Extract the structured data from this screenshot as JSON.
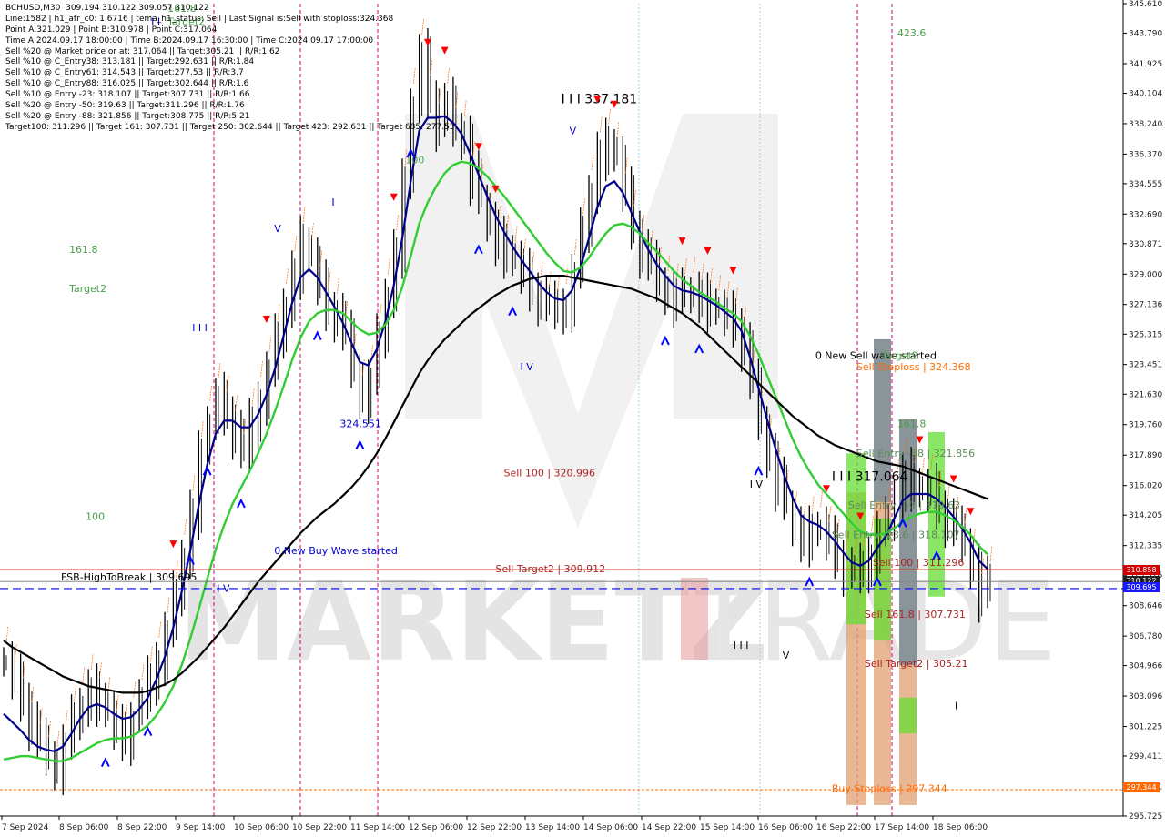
{
  "info_panel": {
    "lines": [
      "BCHUSD,M30  309.194 310.122 309.057 310.122",
      "Line:1582 | h1_atr_c0: 1.6716 | tema_h1_status: Sell | Last Signal is:Sell with stoploss:324.368",
      "Point A:321.029 | Point B:310.978 | Point C:317.064",
      "Time A:2024.09.17 18:00:00 | Time B:2024.09.17 16:30:00 | Time C:2024.09.17 17:00:00",
      "Sell %20 @ Market price or at: 317.064 || Target:305.21 || R/R:1.62",
      "Sell %10 @ C_Entry38: 313.181 || Target:292.631 || R/R:1.84",
      "Sell %10 @ C_Entry61: 314.543 || Target:277.53 || R/R:3.7",
      "Sell %10 @ C_Entry88: 316.025 || Target:302.644 || R/R:1.6",
      "Sell %10 @ Entry -23: 318.107 || Target:307.731 || R/R:1.66",
      "Sell %20 @ Entry -50: 319.63 || Target:311.296 || R/R:1.76",
      "Sell %20 @ Entry -88: 321.856 || Target:308.775 || R/R:5.21",
      "Target100: 311.296 || Target 161: 307.731 || Target 250: 302.644 || Target 423: 292.631 || Target 685: 277.53"
    ]
  },
  "price_tags": {
    "red": "310.858",
    "dark": "310.122",
    "blue": "309.695",
    "orange": "297.344"
  },
  "colors": {
    "candle": "#000000",
    "ma_blue": "#00008b",
    "ma_green": "#32cd32",
    "ma_black": "#000000",
    "resistance": "#d10000",
    "support_blue": "#0000ff",
    "stoploss": "#ff6a00",
    "session_line": "#cc0077",
    "watermark": "#d9d9d9"
  },
  "chart_data": {
    "type": "candlestick",
    "symbol": "BCHUSD,M30",
    "y_ticks": [
      "345.610",
      "343.790",
      "341.925",
      "340.104",
      "338.240",
      "336.370",
      "334.555",
      "332.690",
      "330.871",
      "329.000",
      "327.136",
      "325.315",
      "323.451",
      "321.630",
      "319.760",
      "317.890",
      "316.020",
      "314.205",
      "312.335",
      "310.516",
      "308.646",
      "306.780",
      "304.966",
      "303.096",
      "301.225",
      "299.411",
      "297.541",
      "295.725"
    ],
    "ylim": [
      295.725,
      345.61
    ],
    "x_ticks": [
      "7 Sep 2024",
      "8 Sep 06:00",
      "8 Sep 22:00",
      "9 Sep 14:00",
      "10 Sep 06:00",
      "10 Sep 22:00",
      "11 Sep 14:00",
      "12 Sep 06:00",
      "12 Sep 22:00",
      "13 Sep 14:00",
      "14 Sep 06:00",
      "14 Sep 22:00",
      "15 Sep 14:00",
      "16 Sep 06:00",
      "16 Sep 22:00",
      "17 Sep 14:00",
      "18 Sep 06:00"
    ],
    "close": [
      305.2,
      304.1,
      303.0,
      301.5,
      300.2,
      299.4,
      298.8,
      300.1,
      301.6,
      302.7,
      303.5,
      303.0,
      302.1,
      301.0,
      300.6,
      301.8,
      302.9,
      304.0,
      305.5,
      307.0,
      309.2,
      311.8,
      314.5,
      317.8,
      320.0,
      321.4,
      320.6,
      319.4,
      318.0,
      319.8,
      321.5,
      323.0,
      325.0,
      327.2,
      329.2,
      331.0,
      330.0,
      328.3,
      327.0,
      326.6,
      325.2,
      323.2,
      321.6,
      322.5,
      325.0,
      327.8,
      330.5,
      334.5,
      339.5,
      342.5,
      340.0,
      338.3,
      339.5,
      338.0,
      337.5,
      335.0,
      333.6,
      332.2,
      331.0,
      330.5,
      329.8,
      329.0,
      328.2,
      327.6,
      327.0,
      326.8,
      327.2,
      329.0,
      331.5,
      334.2,
      336.5,
      337.0,
      336.2,
      334.0,
      332.0,
      330.5,
      329.5,
      328.5,
      328.0,
      327.5,
      327.8,
      327.9,
      327.5,
      327.2,
      326.8,
      326.4,
      326.0,
      324.8,
      322.2,
      320.0,
      318.0,
      316.2,
      314.8,
      313.5,
      312.8,
      313.2,
      313.5,
      312.6,
      311.8,
      311.0,
      310.6,
      310.9,
      312.0,
      313.2,
      313.8,
      315.5,
      316.8,
      316.2,
      315.6,
      315.8,
      314.8,
      314.0,
      313.2,
      312.5,
      311.2,
      309.4,
      310.122
    ],
    "series": [
      {
        "name": "fast MA (navy)",
        "values": [
          302.0,
          301.5,
          301.0,
          300.4,
          300.0,
          299.8,
          299.7,
          300.0,
          300.8,
          301.7,
          302.4,
          302.6,
          302.4,
          302.0,
          301.7,
          301.8,
          302.3,
          303.0,
          304.1,
          305.5,
          307.3,
          309.5,
          312.0,
          314.8,
          317.3,
          319.2,
          320.0,
          320.0,
          319.6,
          319.6,
          320.4,
          321.6,
          323.2,
          325.2,
          327.2,
          328.8,
          329.3,
          328.8,
          327.9,
          327.0,
          326.0,
          324.8,
          323.6,
          323.4,
          324.4,
          326.1,
          328.3,
          331.2,
          334.7,
          337.8,
          338.6,
          338.6,
          338.7,
          338.3,
          337.6,
          336.4,
          335.1,
          333.8,
          332.6,
          331.6,
          330.7,
          329.9,
          329.2,
          328.5,
          327.9,
          327.5,
          327.4,
          328.0,
          329.4,
          331.2,
          333.1,
          334.4,
          334.7,
          334.0,
          332.8,
          331.6,
          330.5,
          329.6,
          328.9,
          328.3,
          328.0,
          327.9,
          327.7,
          327.4,
          327.1,
          326.7,
          326.3,
          325.5,
          323.9,
          322.0,
          320.1,
          318.3,
          316.7,
          315.3,
          314.2,
          313.8,
          313.6,
          313.2,
          312.6,
          311.9,
          311.3,
          311.1,
          311.4,
          312.2,
          312.9,
          314.0,
          315.1,
          315.5,
          315.5,
          315.5,
          315.2,
          314.7,
          314.1,
          313.4,
          312.5,
          311.4,
          310.9
        ]
      },
      {
        "name": "slow MA (green)",
        "values": [
          299.2,
          299.3,
          299.4,
          299.4,
          299.3,
          299.2,
          299.1,
          299.1,
          299.3,
          299.6,
          299.9,
          300.2,
          300.4,
          300.5,
          300.5,
          300.6,
          300.9,
          301.3,
          301.9,
          302.7,
          303.7,
          305.0,
          306.6,
          308.4,
          310.3,
          312.1,
          313.6,
          314.9,
          315.9,
          316.9,
          318.0,
          319.2,
          320.6,
          322.1,
          323.7,
          325.1,
          326.1,
          326.6,
          326.8,
          326.8,
          326.6,
          326.1,
          325.6,
          325.3,
          325.4,
          325.9,
          326.8,
          328.2,
          330.1,
          332.1,
          333.4,
          334.4,
          335.2,
          335.7,
          335.9,
          335.8,
          335.5,
          335.0,
          334.4,
          333.8,
          333.1,
          332.4,
          331.7,
          331.0,
          330.3,
          329.7,
          329.2,
          329.1,
          329.4,
          330.0,
          330.8,
          331.5,
          332.0,
          332.1,
          331.9,
          331.5,
          330.9,
          330.4,
          329.8,
          329.2,
          328.7,
          328.3,
          327.9,
          327.6,
          327.3,
          326.9,
          326.6,
          326.1,
          325.2,
          324.1,
          322.8,
          321.5,
          320.2,
          318.9,
          317.8,
          316.9,
          316.1,
          315.5,
          314.9,
          314.3,
          313.7,
          313.2,
          313.0,
          313.0,
          313.1,
          313.4,
          313.8,
          314.1,
          314.3,
          314.4,
          314.4,
          314.2,
          313.9,
          313.5,
          313.0,
          312.3,
          311.8
        ]
      },
      {
        "name": "long MA (black)",
        "values": [
          306.5,
          306.1,
          305.8,
          305.5,
          305.2,
          304.9,
          304.6,
          304.3,
          304.1,
          303.9,
          303.7,
          303.6,
          303.5,
          303.4,
          303.3,
          303.3,
          303.3,
          303.4,
          303.6,
          303.8,
          304.1,
          304.5,
          305.0,
          305.5,
          306.1,
          306.7,
          307.3,
          308.0,
          308.7,
          309.4,
          310.1,
          310.7,
          311.3,
          311.9,
          312.5,
          313.1,
          313.6,
          314.1,
          314.5,
          314.9,
          315.4,
          315.9,
          316.5,
          317.2,
          318.0,
          318.9,
          319.9,
          320.9,
          321.9,
          322.9,
          323.7,
          324.4,
          325.0,
          325.5,
          326.0,
          326.5,
          326.9,
          327.3,
          327.7,
          328.0,
          328.3,
          328.5,
          328.7,
          328.8,
          328.9,
          328.9,
          328.9,
          328.8,
          328.7,
          328.6,
          328.5,
          328.4,
          328.3,
          328.2,
          328.1,
          327.9,
          327.7,
          327.5,
          327.2,
          326.9,
          326.6,
          326.2,
          325.8,
          325.3,
          324.8,
          324.3,
          323.8,
          323.3,
          322.8,
          322.3,
          321.8,
          321.3,
          320.8,
          320.3,
          319.9,
          319.5,
          319.1,
          318.8,
          318.5,
          318.3,
          318.1,
          317.9,
          317.7,
          317.5,
          317.4,
          317.3,
          317.2,
          317.0,
          316.8,
          316.6,
          316.4,
          316.2,
          316.0,
          315.8,
          315.6,
          315.4,
          315.2
        ]
      }
    ],
    "levels": {
      "resistance_red": 310.858,
      "current_price": 310.122,
      "fsb_blue_dashed": 309.695,
      "buy_stoploss": 297.344
    },
    "annotations": [
      {
        "text": "161.8",
        "color": "#4a9e4a",
        "x": 20,
        "y": 345.1
      },
      {
        "text": "Target2",
        "color": "#4a9e4a",
        "x": 20,
        "y": 344.3
      },
      {
        "text": "I I",
        "color": "#0000cc",
        "x": 18,
        "y": 344.3
      },
      {
        "text": "423.6",
        "color": "#4a9e4a",
        "x": 109,
        "y": 343.6
      },
      {
        "text": "I I I 337.181",
        "color": "#000000",
        "x": 68,
        "y": 339.5
      },
      {
        "text": "V",
        "color": "#0000cc",
        "x": 69,
        "y": 337.6
      },
      {
        "text": "100",
        "color": "#4a9e4a",
        "x": 49,
        "y": 335.8
      },
      {
        "text": "I",
        "color": "#0000cc",
        "x": 40,
        "y": 333.2
      },
      {
        "text": "V",
        "color": "#0000cc",
        "x": 33,
        "y": 331.6
      },
      {
        "text": "161.8",
        "color": "#4a9e4a",
        "x": 8,
        "y": 330.3
      },
      {
        "text": "Target2",
        "color": "#4a9e4a",
        "x": 8,
        "y": 327.9
      },
      {
        "text": "I I I",
        "color": "#0000cc",
        "x": 23,
        "y": 325.5
      },
      {
        "text": "I V",
        "color": "#0000cc",
        "x": 63,
        "y": 323.1
      },
      {
        "text": "0 New Sell wave started",
        "color": "#000000",
        "x": 99,
        "y": 323.8
      },
      {
        "text": "Target2",
        "color": "#4a9e4a",
        "x": 107,
        "y": 323.8
      },
      {
        "text": "Sell Stoploss | 324.368",
        "color": "#ff6a00",
        "x": 104,
        "y": 323.1
      },
      {
        "text": "324.551",
        "color": "#0000cc",
        "x": 41,
        "y": 319.6
      },
      {
        "text": "161.8",
        "color": "#4a9e4a",
        "x": 109,
        "y": 319.6
      },
      {
        "text": "Sell Entry -88 | 321.856",
        "color": "#5b8a5b",
        "x": 104,
        "y": 317.8
      },
      {
        "text": "Sell 100 | 320.996",
        "color": "#b22222",
        "x": 61,
        "y": 316.6
      },
      {
        "text": "I I I 317.064",
        "color": "#000000",
        "x": 101,
        "y": 316.3
      },
      {
        "text": "I V",
        "color": "#000000",
        "x": 91,
        "y": 315.9
      },
      {
        "text": "Sell Entry -50 | 319.63",
        "color": "#5b8a5b",
        "x": 103,
        "y": 314.6
      },
      {
        "text": "100",
        "color": "#4a9e4a",
        "x": 10,
        "y": 313.9
      },
      {
        "text": "I V",
        "color": "#0000cc",
        "x": 26,
        "y": 309.5
      },
      {
        "text": "Sell Entry -23.6 | 318.107",
        "color": "#5b8a5b",
        "x": 101,
        "y": 312.8
      },
      {
        "text": "0 New Buy Wave started",
        "color": "#0000cc",
        "x": 33,
        "y": 311.8
      },
      {
        "text": "FSB-HighToBreak | 309.695",
        "color": "#000000",
        "x": 7,
        "y": 310.2
      },
      {
        "text": "Sell Target2 | 309.912",
        "color": "#b22222",
        "x": 60,
        "y": 310.7
      },
      {
        "text": "Sell 100 | 311.296",
        "color": "#b22222",
        "x": 106,
        "y": 311.1
      },
      {
        "text": "Sell 161.8 | 307.731",
        "color": "#b22222",
        "x": 105,
        "y": 307.9
      },
      {
        "text": "I I I",
        "color": "#000000",
        "x": 89,
        "y": 306.0
      },
      {
        "text": "V",
        "color": "#000000",
        "x": 95,
        "y": 305.4
      },
      {
        "text": "Sell Target2 | 305.21",
        "color": "#b22222",
        "x": 105,
        "y": 304.9
      },
      {
        "text": "I",
        "color": "#000000",
        "x": 116,
        "y": 302.3
      },
      {
        "text": "Buy Stoploss | 297.344",
        "color": "#ff6a00",
        "x": 101,
        "y": 297.2
      }
    ]
  }
}
